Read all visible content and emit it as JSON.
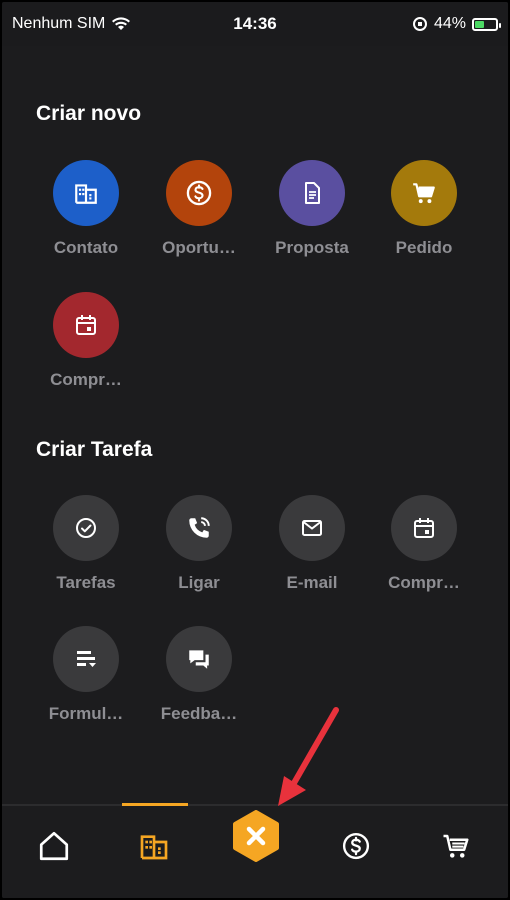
{
  "status_bar": {
    "carrier": "Nenhum SIM",
    "time": "14:36",
    "battery_percent": "44%",
    "battery_level": 0.44
  },
  "sections": {
    "create_new": {
      "title": "Criar novo",
      "items": [
        {
          "label": "Contato",
          "icon": "building-icon",
          "color": "#1d5fc9"
        },
        {
          "label": "Oportu…",
          "icon": "dollar-icon",
          "color": "#b3440c"
        },
        {
          "label": "Proposta",
          "icon": "document-icon",
          "color": "#5a4fa0"
        },
        {
          "label": "Pedido",
          "icon": "cart-icon",
          "color": "#a47a0c"
        },
        {
          "label": "Compr…",
          "icon": "calendar-icon",
          "color": "#a3282e"
        }
      ]
    },
    "create_task": {
      "title": "Criar Tarefa",
      "items": [
        {
          "label": "Tarefas",
          "icon": "check-circle-icon",
          "color": "#3a3a3c"
        },
        {
          "label": "Ligar",
          "icon": "phone-icon",
          "color": "#3a3a3c"
        },
        {
          "label": "E-mail",
          "icon": "mail-icon",
          "color": "#3a3a3c"
        },
        {
          "label": "Compr…",
          "icon": "calendar-icon",
          "color": "#3a3a3c"
        },
        {
          "label": "Formul…",
          "icon": "form-icon",
          "color": "#3a3a3c"
        },
        {
          "label": "Feedba…",
          "icon": "chat-icon",
          "color": "#3a3a3c"
        }
      ]
    }
  },
  "bottom_nav": {
    "items": [
      {
        "name": "home",
        "icon": "home-icon"
      },
      {
        "name": "companies",
        "icon": "building-icon",
        "active": true
      },
      {
        "name": "close",
        "icon": "close-icon"
      },
      {
        "name": "opportunities",
        "icon": "dollar-icon"
      },
      {
        "name": "orders",
        "icon": "cart-icon"
      }
    ],
    "accent_color": "#f5a623"
  },
  "annotation": {
    "arrow_color": "#e8323c"
  }
}
